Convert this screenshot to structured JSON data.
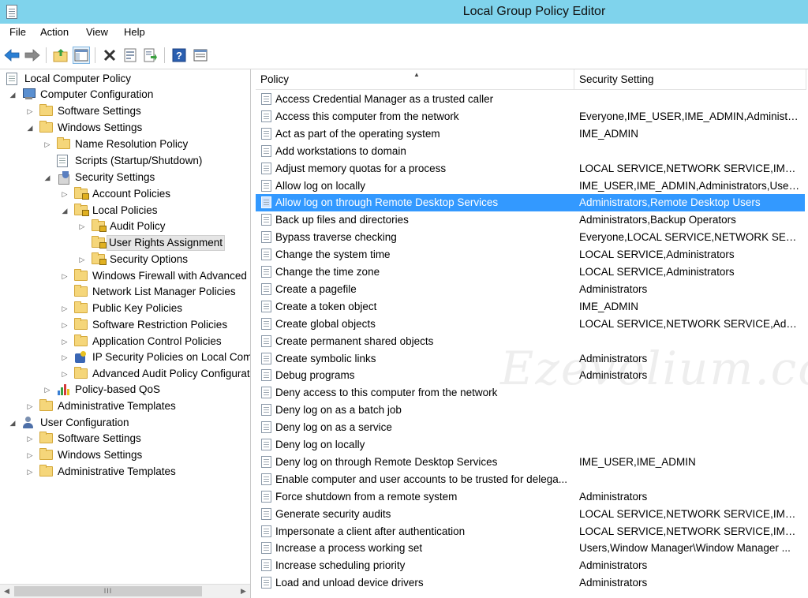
{
  "window": {
    "title": "Local Group Policy Editor"
  },
  "menu": [
    "File",
    "Action",
    "View",
    "Help"
  ],
  "toolbar": {
    "icons": [
      "back-arrow-icon",
      "forward-arrow-icon",
      "up-folder-icon",
      "show-hide-tree-icon",
      "delete-icon",
      "properties-icon",
      "export-list-icon",
      "help-icon",
      "console-icon"
    ]
  },
  "tree": {
    "items": [
      {
        "label": "Local Computer Policy"
      },
      {
        "label": "Computer Configuration"
      },
      {
        "label": "Software Settings"
      },
      {
        "label": "Windows Settings"
      },
      {
        "label": "Name Resolution Policy"
      },
      {
        "label": "Scripts (Startup/Shutdown)"
      },
      {
        "label": "Security Settings"
      },
      {
        "label": "Account Policies"
      },
      {
        "label": "Local Policies"
      },
      {
        "label": "Audit Policy"
      },
      {
        "label": "User Rights Assignment"
      },
      {
        "label": "Security Options"
      },
      {
        "label": "Windows Firewall with Advanced Security"
      },
      {
        "label": "Network List Manager Policies"
      },
      {
        "label": "Public Key Policies"
      },
      {
        "label": "Software Restriction Policies"
      },
      {
        "label": "Application Control Policies"
      },
      {
        "label": "IP Security Policies on Local Computer"
      },
      {
        "label": "Advanced Audit Policy Configuration"
      },
      {
        "label": "Policy-based QoS"
      },
      {
        "label": "Administrative Templates"
      },
      {
        "label": "User Configuration"
      },
      {
        "label": "Software Settings"
      },
      {
        "label": "Windows Settings"
      },
      {
        "label": "Administrative Templates"
      }
    ],
    "scrollbar_thumb": "III"
  },
  "list": {
    "columns": [
      "Policy",
      "Security Setting"
    ],
    "rows": [
      {
        "policy": "Access Credential Manager as a trusted caller",
        "setting": ""
      },
      {
        "policy": "Access this computer from the network",
        "setting": "Everyone,IME_USER,IME_ADMIN,Administra..."
      },
      {
        "policy": "Act as part of the operating system",
        "setting": "IME_ADMIN"
      },
      {
        "policy": "Add workstations to domain",
        "setting": ""
      },
      {
        "policy": "Adjust memory quotas for a process",
        "setting": "LOCAL SERVICE,NETWORK SERVICE,IME_AD..."
      },
      {
        "policy": "Allow log on locally",
        "setting": "IME_USER,IME_ADMIN,Administrators,Users..."
      },
      {
        "policy": "Allow log on through Remote Desktop Services",
        "setting": "Administrators,Remote Desktop Users"
      },
      {
        "policy": "Back up files and directories",
        "setting": "Administrators,Backup Operators"
      },
      {
        "policy": "Bypass traverse checking",
        "setting": "Everyone,LOCAL SERVICE,NETWORK SERVIC..."
      },
      {
        "policy": "Change the system time",
        "setting": "LOCAL SERVICE,Administrators"
      },
      {
        "policy": "Change the time zone",
        "setting": "LOCAL SERVICE,Administrators"
      },
      {
        "policy": "Create a pagefile",
        "setting": "Administrators"
      },
      {
        "policy": "Create a token object",
        "setting": "IME_ADMIN"
      },
      {
        "policy": "Create global objects",
        "setting": "LOCAL SERVICE,NETWORK SERVICE,Admini..."
      },
      {
        "policy": "Create permanent shared objects",
        "setting": ""
      },
      {
        "policy": "Create symbolic links",
        "setting": "Administrators"
      },
      {
        "policy": "Debug programs",
        "setting": "Administrators"
      },
      {
        "policy": "Deny access to this computer from the network",
        "setting": ""
      },
      {
        "policy": "Deny log on as a batch job",
        "setting": ""
      },
      {
        "policy": "Deny log on as a service",
        "setting": ""
      },
      {
        "policy": "Deny log on locally",
        "setting": ""
      },
      {
        "policy": "Deny log on through Remote Desktop Services",
        "setting": "IME_USER,IME_ADMIN"
      },
      {
        "policy": "Enable computer and user accounts to be trusted for delega...",
        "setting": ""
      },
      {
        "policy": "Force shutdown from a remote system",
        "setting": "Administrators"
      },
      {
        "policy": "Generate security audits",
        "setting": "LOCAL SERVICE,NETWORK SERVICE,IME_US..."
      },
      {
        "policy": "Impersonate a client after authentication",
        "setting": "LOCAL SERVICE,NETWORK SERVICE,IME_AD..."
      },
      {
        "policy": "Increase a process working set",
        "setting": "Users,Window Manager\\Window Manager ..."
      },
      {
        "policy": "Increase scheduling priority",
        "setting": "Administrators"
      },
      {
        "policy": "Load and unload device drivers",
        "setting": "Administrators"
      }
    ]
  },
  "watermark": "Ezevolium.com",
  "colors": {
    "titlebar": "#7fd3ec",
    "selection": "#3399ff",
    "folder": "#f5d67a"
  }
}
